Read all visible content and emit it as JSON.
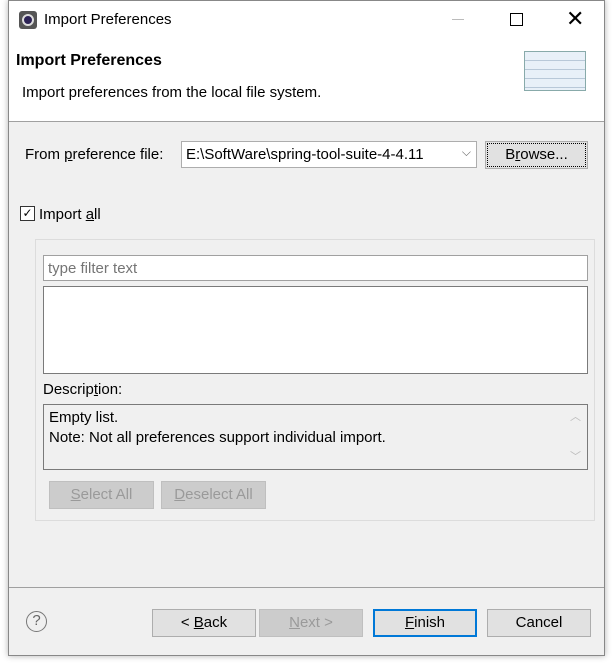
{
  "window": {
    "title": "Import Preferences"
  },
  "header": {
    "title": "Import Preferences",
    "subtitle": "Import preferences from the local file system."
  },
  "file": {
    "label_pre": "From ",
    "label_u": "p",
    "label_post": "reference file:",
    "value": "E:\\SoftWare\\spring-tool-suite-4-4.11",
    "browse_pre": "B",
    "browse_u": "r",
    "browse_post": "owse..."
  },
  "import_all": {
    "checked": true,
    "pre": "Import ",
    "u": "a",
    "post": "ll"
  },
  "filter": {
    "placeholder": "type filter text"
  },
  "description": {
    "label_pre": "Descrip",
    "label_u": "t",
    "label_post": "ion:",
    "line1": "Empty list.",
    "line2": "Note: Not all preferences support individual import."
  },
  "select_all": {
    "u": "S",
    "rest": "elect All"
  },
  "deselect_all": {
    "u": "D",
    "rest": "eselect All"
  },
  "footer": {
    "back_pre": "< ",
    "back_u": "B",
    "back_post": "ack",
    "next_u": "N",
    "next_post": "ext >",
    "finish_u": "F",
    "finish_post": "inish",
    "cancel": "Cancel"
  }
}
